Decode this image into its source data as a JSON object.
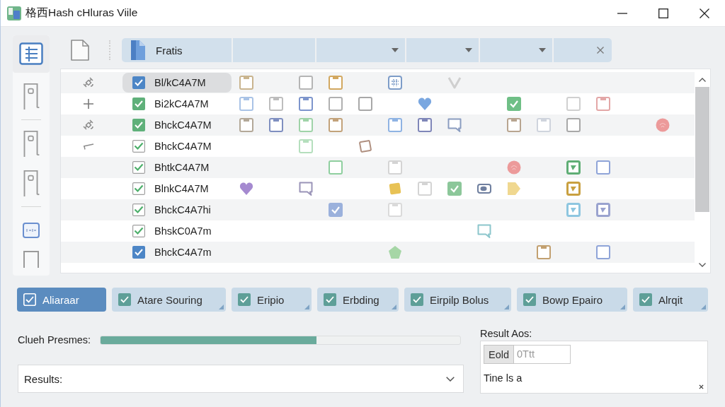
{
  "window": {
    "title": "格西Hash cHluras Viile"
  },
  "sidebar": {
    "groups": [
      {
        "items": [
          {
            "kind": "list",
            "selected": true
          },
          {
            "kind": "door",
            "selected": false
          }
        ]
      },
      {
        "items": [
          {
            "kind": "door",
            "selected": false
          },
          {
            "kind": "door",
            "selected": false
          }
        ]
      },
      {
        "items": [
          {
            "kind": "card",
            "selected": false
          },
          {
            "kind": "frame",
            "selected": false
          }
        ]
      }
    ]
  },
  "filter_bar": {
    "segments": [
      {
        "kind": "path",
        "text": "Fratis"
      },
      {
        "kind": "field"
      },
      {
        "kind": "dropdown"
      },
      {
        "kind": "dropdown"
      },
      {
        "kind": "dropdown"
      },
      {
        "kind": "clear"
      }
    ]
  },
  "table": {
    "rows": [
      {
        "marker": {
          "kind": "satellite"
        },
        "selected": true,
        "checkbox": {
          "checked": true,
          "filled": true,
          "color": "#4d86c6"
        },
        "name": "Bl/kC4A7M",
        "cells": [
          {
            "kind": "note",
            "color": "#c9b48e"
          },
          {
            "kind": "empty"
          },
          {
            "kind": "square",
            "color": "#b5b5b5"
          },
          {
            "kind": "note",
            "color": "#d2a860"
          },
          {
            "kind": "empty"
          },
          {
            "kind": "grid",
            "color": "#7d9cc8"
          },
          {
            "kind": "empty"
          },
          {
            "kind": "tick",
            "color": "#cfcfcf"
          },
          {
            "kind": "empty"
          },
          {
            "kind": "empty"
          },
          {
            "kind": "empty"
          },
          {
            "kind": "empty"
          },
          {
            "kind": "empty"
          },
          {
            "kind": "empty"
          },
          {
            "kind": "empty"
          }
        ]
      },
      {
        "marker": {
          "kind": "plus"
        },
        "selected": false,
        "checkbox": {
          "checked": true,
          "filled": true,
          "color": "#5fb07a"
        },
        "name": "Bi2kC4A7M",
        "cells": [
          {
            "kind": "note",
            "color": "#a9c3e6"
          },
          {
            "kind": "note",
            "color": "#bdbdbd"
          },
          {
            "kind": "note",
            "color": "#7d95cc"
          },
          {
            "kind": "square",
            "color": "#b0b0b0"
          },
          {
            "kind": "square",
            "color": "#a8a8a8"
          },
          {
            "kind": "empty"
          },
          {
            "kind": "heart",
            "color": "#7aa7e0"
          },
          {
            "kind": "empty"
          },
          {
            "kind": "empty"
          },
          {
            "kind": "checked",
            "color": "#6fbf86"
          },
          {
            "kind": "empty"
          },
          {
            "kind": "square",
            "color": "#d0d0d0"
          },
          {
            "kind": "note",
            "color": "#e3a7a7"
          },
          {
            "kind": "empty"
          },
          {
            "kind": "empty"
          }
        ]
      },
      {
        "marker": {
          "kind": "satellite"
        },
        "selected": false,
        "checkbox": {
          "checked": true,
          "filled": true,
          "color": "#5fb07a"
        },
        "name": "BhckC4A7M",
        "cells": [
          {
            "kind": "note",
            "color": "#b3a898"
          },
          {
            "kind": "note",
            "color": "#7f8fc0"
          },
          {
            "kind": "note",
            "color": "#9fd3a8"
          },
          {
            "kind": "note",
            "color": "#c2a27a"
          },
          {
            "kind": "empty"
          },
          {
            "kind": "note",
            "color": "#8fb3e3"
          },
          {
            "kind": "note",
            "color": "#7f86b8"
          },
          {
            "kind": "bubble",
            "color": "#8a9cc0"
          },
          {
            "kind": "empty"
          },
          {
            "kind": "note",
            "color": "#b8a590"
          },
          {
            "kind": "note",
            "color": "#cfd4dd"
          },
          {
            "kind": "square",
            "color": "#a8a8a8"
          },
          {
            "kind": "empty"
          },
          {
            "kind": "empty"
          },
          {
            "kind": "rosette",
            "color": "#ec9a9a"
          }
        ]
      },
      {
        "marker": {
          "kind": "corner"
        },
        "selected": false,
        "checkbox": {
          "checked": true,
          "filled": false
        },
        "name": "BhckC4A7M",
        "cells": [
          {
            "kind": "empty"
          },
          {
            "kind": "empty"
          },
          {
            "kind": "note",
            "color": "#b5dfbd"
          },
          {
            "kind": "empty"
          },
          {
            "kind": "tilted",
            "color": "#b09080"
          },
          {
            "kind": "empty"
          },
          {
            "kind": "empty"
          },
          {
            "kind": "empty"
          },
          {
            "kind": "empty"
          },
          {
            "kind": "empty"
          },
          {
            "kind": "empty"
          },
          {
            "kind": "empty"
          },
          {
            "kind": "empty"
          },
          {
            "kind": "empty"
          },
          {
            "kind": "empty"
          }
        ]
      },
      {
        "selected": false,
        "checkbox": {
          "checked": true,
          "filled": false
        },
        "name": "BhtkC4A7M",
        "cells": [
          {
            "kind": "empty"
          },
          {
            "kind": "empty"
          },
          {
            "kind": "empty"
          },
          {
            "kind": "square",
            "color": "#8fcf9f"
          },
          {
            "kind": "empty"
          },
          {
            "kind": "note",
            "color": "#d4d4d4"
          },
          {
            "kind": "empty"
          },
          {
            "kind": "empty"
          },
          {
            "kind": "empty"
          },
          {
            "kind": "rosette",
            "color": "#ec9a9a"
          },
          {
            "kind": "empty"
          },
          {
            "kind": "framed",
            "color": "#5fae75"
          },
          {
            "kind": "square",
            "color": "#8fa4d8"
          },
          {
            "kind": "empty"
          },
          {
            "kind": "empty"
          }
        ]
      },
      {
        "selected": false,
        "checkbox": {
          "checked": true,
          "filled": false
        },
        "name": "BlnkC4A7M",
        "cells": [
          {
            "kind": "heart",
            "color": "#a58ad0"
          },
          {
            "kind": "empty"
          },
          {
            "kind": "bubble",
            "color": "#9a94b8"
          },
          {
            "kind": "empty"
          },
          {
            "kind": "empty"
          },
          {
            "kind": "sticky",
            "color": "#e8c255"
          },
          {
            "kind": "note",
            "color": "#d4d4d4"
          },
          {
            "kind": "checked",
            "color": "#8cc79a"
          },
          {
            "kind": "camera",
            "color": "#6f7f9f"
          },
          {
            "kind": "pennant",
            "color": "#f0d890"
          },
          {
            "kind": "empty"
          },
          {
            "kind": "framed",
            "color": "#c9a040"
          },
          {
            "kind": "empty"
          },
          {
            "kind": "empty"
          },
          {
            "kind": "empty"
          }
        ]
      },
      {
        "selected": false,
        "checkbox": {
          "checked": true,
          "filled": false
        },
        "name": "BhckC4A7hi",
        "cells": [
          {
            "kind": "empty"
          },
          {
            "kind": "empty"
          },
          {
            "kind": "empty"
          },
          {
            "kind": "checked",
            "color": "#9bb1dc"
          },
          {
            "kind": "empty"
          },
          {
            "kind": "note",
            "color": "#dadada"
          },
          {
            "kind": "empty"
          },
          {
            "kind": "empty"
          },
          {
            "kind": "empty"
          },
          {
            "kind": "empty"
          },
          {
            "kind": "empty"
          },
          {
            "kind": "framed",
            "color": "#8ec6e0"
          },
          {
            "kind": "framed",
            "color": "#9aa3cf"
          },
          {
            "kind": "empty"
          },
          {
            "kind": "empty"
          }
        ]
      },
      {
        "selected": false,
        "checkbox": {
          "checked": true,
          "filled": false
        },
        "name": "BhskC0A7m",
        "cells": [
          {
            "kind": "empty"
          },
          {
            "kind": "empty"
          },
          {
            "kind": "empty"
          },
          {
            "kind": "empty"
          },
          {
            "kind": "empty"
          },
          {
            "kind": "empty"
          },
          {
            "kind": "empty"
          },
          {
            "kind": "empty"
          },
          {
            "kind": "bubble",
            "color": "#8cc6cc"
          },
          {
            "kind": "empty"
          },
          {
            "kind": "empty"
          },
          {
            "kind": "empty"
          },
          {
            "kind": "empty"
          },
          {
            "kind": "empty"
          },
          {
            "kind": "empty"
          }
        ]
      },
      {
        "selected": false,
        "checkbox": {
          "checked": true,
          "filled": true,
          "color": "#4d86c6"
        },
        "name": "BhckC4A7m",
        "cells": [
          {
            "kind": "empty"
          },
          {
            "kind": "empty"
          },
          {
            "kind": "empty"
          },
          {
            "kind": "empty"
          },
          {
            "kind": "empty"
          },
          {
            "kind": "pentagon",
            "color": "#a6d6a6"
          },
          {
            "kind": "empty"
          },
          {
            "kind": "empty"
          },
          {
            "kind": "empty"
          },
          {
            "kind": "empty"
          },
          {
            "kind": "note",
            "color": "#c2a070"
          },
          {
            "kind": "empty"
          },
          {
            "kind": "square",
            "color": "#8fa4d8"
          },
          {
            "kind": "empty"
          },
          {
            "kind": "empty"
          }
        ]
      }
    ]
  },
  "chips": [
    {
      "label": "Aliaraar",
      "checked": true,
      "selected": true
    },
    {
      "label": "Atare Souring",
      "checked": true,
      "selected": false
    },
    {
      "label": "Eripio",
      "checked": true,
      "selected": false
    },
    {
      "label": "Erbding",
      "checked": true,
      "selected": false
    },
    {
      "label": "Eirpilp Bolus",
      "checked": true,
      "selected": false
    },
    {
      "label": "Bowp Epairo",
      "checked": true,
      "selected": false
    },
    {
      "label": "Alrqit",
      "checked": true,
      "selected": false
    }
  ],
  "progress": {
    "label": "Clueh Presmes:",
    "level": 0.6
  },
  "results_select": {
    "label": "Results:"
  },
  "result_panel": {
    "label": "Result Aos:",
    "button": "Eold",
    "field_value": "0Ttt",
    "text": "Tine ls a"
  }
}
